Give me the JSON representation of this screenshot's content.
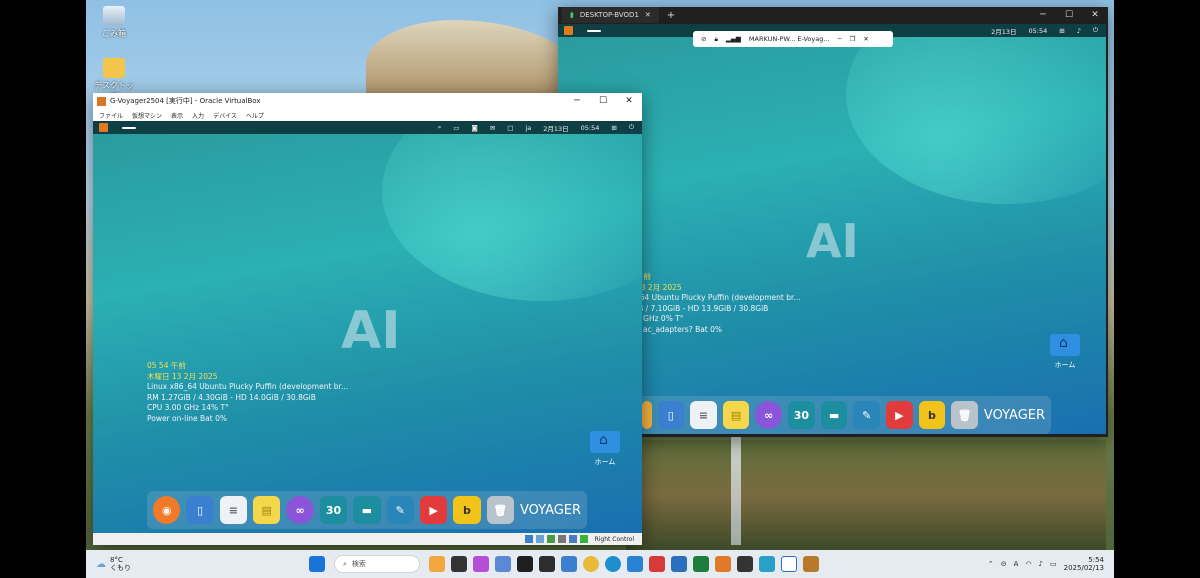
{
  "desktop": {
    "icons": [
      {
        "label": "ごみ箱"
      },
      {
        "label": "デスクトップ"
      }
    ]
  },
  "vbox_window": {
    "title": "G-Voyager2504 [実行中] - Oracle VirtualBox",
    "menu": [
      "ファイル",
      "仮想マシン",
      "表示",
      "入力",
      "デバイス",
      "ヘルプ"
    ],
    "panel_right": {
      "lang": "ja",
      "date": "2月13日",
      "time": "05:54"
    },
    "ai_text": "AI",
    "conky": {
      "time": "05 54 午前",
      "date": "木曜日 13 2月 2025",
      "os": "Linux x86_64 Ubuntu Plucky Puffin (development br...",
      "ram": "RM 1.27GiB / 4.30GiB - HD 14.0GiB / 30.8GiB",
      "cpu": "CPU 3.00 GHz 14%  T°",
      "power": "Power on-line Bat 0%"
    },
    "home_label": "ホーム",
    "dock_label": "VOYAGER",
    "calendar_day": "30",
    "status_text": "Right Control"
  },
  "rdp_window": {
    "tab_title": "DESKTOP-BVOD1",
    "connection_bar": "MARKUN-PW... E-Voyag...",
    "panel_right": {
      "date": "2月13日",
      "time": "05:54"
    },
    "ai_text": "AI",
    "conky": {
      "time": "午前",
      "date": "13 2月 2025",
      "os": "_64 Ubuntu Plucky Puffin (development br...",
      "ram": "iB / 7.10GiB - HD 13.9GiB / 30.8GiB",
      "cpu": "6 GHz 0%  T°",
      "power": "o ac_adapters? Bat 0%"
    },
    "home_label": "ホーム",
    "dock_label": "VOYAGER",
    "calendar_day": "30"
  },
  "taskbar": {
    "weather_temp": "8°C",
    "weather_desc": "くもり",
    "search_placeholder": "検索",
    "tray_lang": "A",
    "clock_time": "5:54",
    "clock_date": "2025/02/13"
  },
  "colors": {
    "guest_panel": "#0e3f44",
    "guest_bg": "#2bb0b3",
    "accent_yellow": "#f2df5a",
    "taskbar": "#e6ebf1"
  }
}
